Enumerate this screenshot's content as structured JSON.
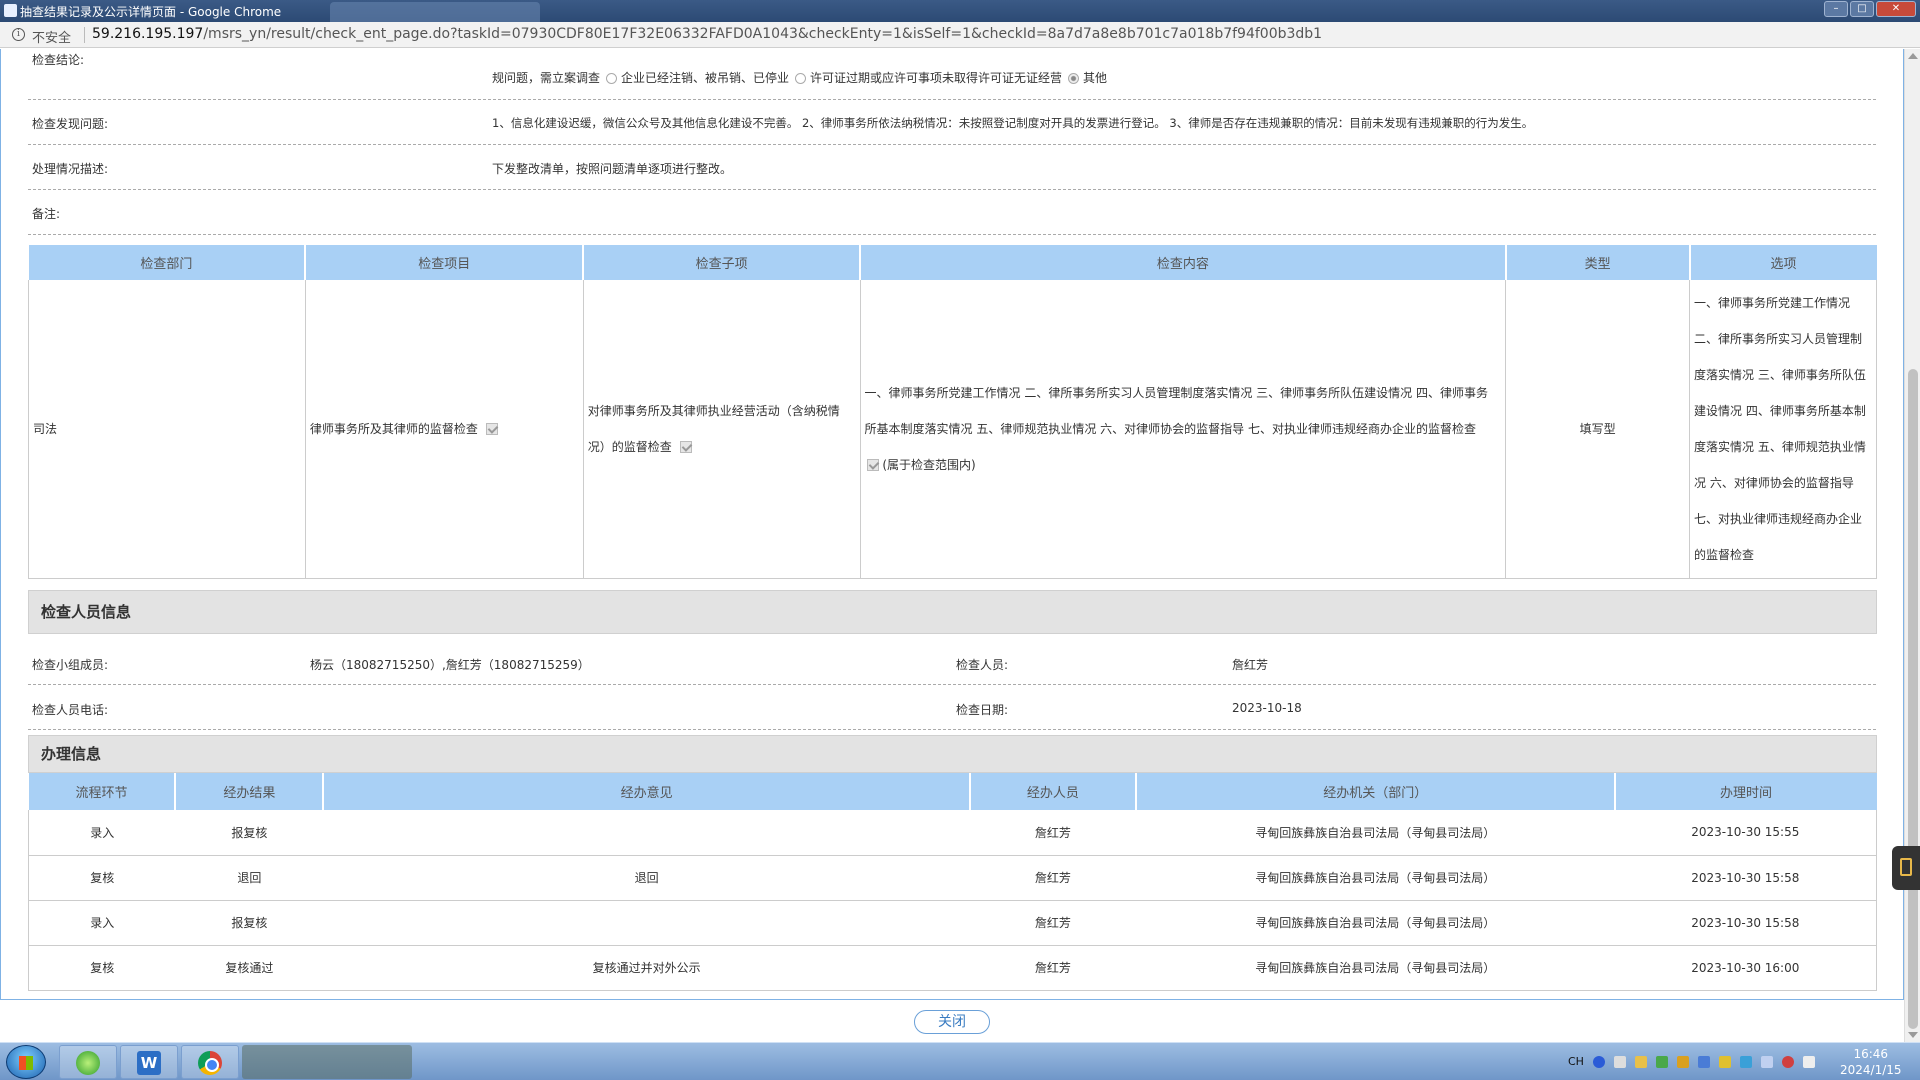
{
  "window": {
    "title": "抽查结果记录及公示详情页面 - Google Chrome"
  },
  "address_bar": {
    "security": "不安全",
    "url_host": "59.216.195.197",
    "url_rest": "/msrs_yn/result/check_ent_page.do?taskId=07930CDF80E17F32E06332FAFD0A1043&checkEnty=1&isSelf=1&checkId=8a7d7a8e8b701c7a018b7f94f00b3db1"
  },
  "form": {
    "conclusion_label": "检查结论:",
    "conclusion_options": [
      "规问题，需立案调查",
      "企业已经注销、被吊销、已停业",
      "许可证过期或应许可事项未取得许可证无证经营",
      "其他"
    ],
    "issues_label": "检查发现问题:",
    "issues_value": "1、信息化建设迟缓，微信公众号及其他信息化建设不完善。 2、律师事务所依法纳税情况：未按照登记制度对开具的发票进行登记。 3、律师是否存在违规兼职的情况：目前未发现有违规兼职的行为发生。",
    "handling_label": "处理情况描述:",
    "handling_value": "下发整改清单，按照问题清单逐项进行整改。",
    "remarks_label": "备注:"
  },
  "inspection_table": {
    "headers": [
      "检查部门",
      "检查项目",
      "检查子项",
      "检查内容",
      "类型",
      "选项"
    ],
    "row": {
      "dept": "司法",
      "item": "律师事务所及其律师的监督检查",
      "subitem": "对律师事务所及其律师执业经营活动（含纳税情况）的监督检查",
      "content": "一、律师事务所党建工作情况 二、律所事务所实习人员管理制度落实情况 三、律师事务所队伍建设情况 四、律师事务所基本制度落实情况 五、律师规范执业情况 六、对律师协会的监督指导 七、对执业律师违规经商办企业的监督检查",
      "content_note": "(属于检查范围内)",
      "type": "填写型",
      "options": "一、律师事务所党建工作情况 二、律所事务所实习人员管理制度落实情况 三、律师事务所队伍建设情况 四、律师事务所基本制度落实情况 五、律师规范执业情况 六、对律师协会的监督指导 七、对执业律师违规经商办企业的监督检查"
    }
  },
  "inspector": {
    "section_title": "检查人员信息",
    "group_label": "检查小组成员:",
    "group_value": "杨云（18082715250）,詹红芳（18082715259）",
    "person_label": "检查人员:",
    "person_value": "詹红芳",
    "phone_label": "检查人员电话:",
    "date_label": "检查日期:",
    "date_value": "2023-10-18"
  },
  "process": {
    "section_title": "办理信息",
    "headers": [
      "流程环节",
      "经办结果",
      "经办意见",
      "经办人员",
      "经办机关（部门）",
      "办理时间"
    ],
    "rows": [
      [
        "录入",
        "报复核",
        "",
        "詹红芳",
        "寻甸回族彝族自治县司法局（寻甸县司法局）",
        "2023-10-30 15:55"
      ],
      [
        "复核",
        "退回",
        "退回",
        "詹红芳",
        "寻甸回族彝族自治县司法局（寻甸县司法局）",
        "2023-10-30 15:58"
      ],
      [
        "录入",
        "报复核",
        "",
        "詹红芳",
        "寻甸回族彝族自治县司法局（寻甸县司法局）",
        "2023-10-30 15:58"
      ],
      [
        "复核",
        "复核通过",
        "复核通过并对外公示",
        "詹红芳",
        "寻甸回族彝族自治县司法局（寻甸县司法局）",
        "2023-10-30 16:00"
      ]
    ]
  },
  "close_button": "关闭",
  "taskbar": {
    "word_icon": "W",
    "lang": "CH",
    "time": "16:46",
    "date": "2024/1/15"
  }
}
